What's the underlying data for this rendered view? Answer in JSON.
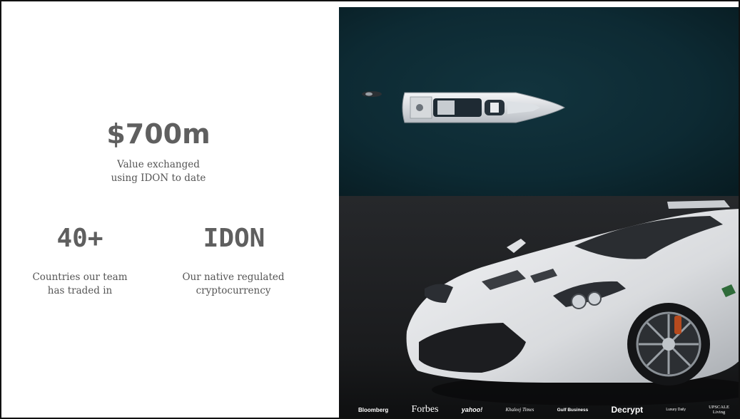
{
  "stats": {
    "value_exchanged": {
      "figure": "$700m",
      "desc_line1": "Value exchanged",
      "desc_line2": "using IDON to date"
    },
    "countries": {
      "figure": "40+",
      "desc_line1": "Countries our team",
      "desc_line2": "has traded in"
    },
    "currency": {
      "figure": "IDON",
      "desc_line1": "Our native regulated",
      "desc_line2": "cryptocurrency"
    }
  },
  "press_logos": [
    "Bloomberg",
    "Forbes",
    "yahoo!",
    "Khaleej Times",
    "Gulf Business",
    "Decrypt",
    "Luxury Daily",
    "UPSCALE",
    "Living"
  ],
  "colors": {
    "stat_text": "#5f5f5f",
    "sea": "#0d2a33",
    "showroom": "#1a1b1d",
    "car_body": "#e6e7e9"
  }
}
